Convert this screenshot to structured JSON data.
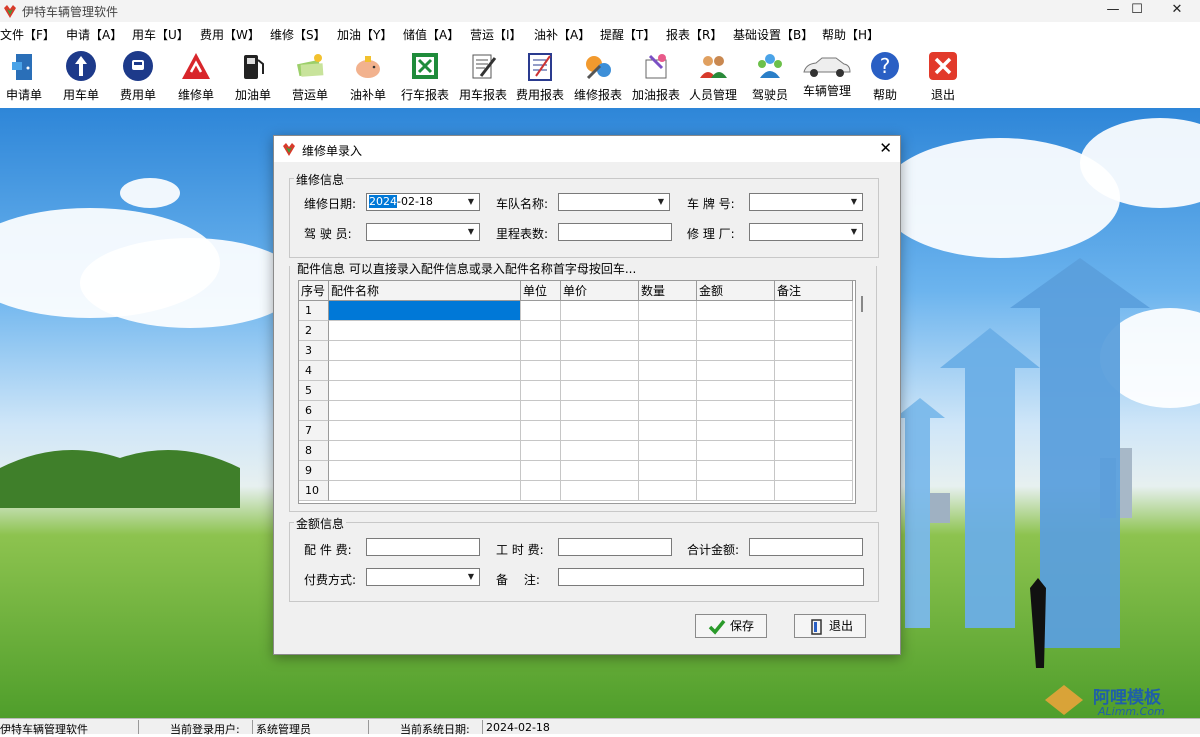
{
  "window": {
    "title": "伊特车辆管理软件",
    "controls": {
      "minimize": "—",
      "maximize": "☐",
      "close": "✕"
    }
  },
  "menu": [
    "文件【F】",
    "申请【A】",
    "用车【U】",
    "费用【W】",
    "维修【S】",
    "加油【Y】",
    "储值【A】",
    "营运【I】",
    "油补【A】",
    "提醒【T】",
    "报表【R】",
    "基础设置【B】",
    "帮助【H】"
  ],
  "toolbar": [
    "申请单",
    "用车单",
    "费用单",
    "维修单",
    "加油单",
    "营运单",
    "油补单",
    "行车报表",
    "用车报表",
    "费用报表",
    "维修报表",
    "加油报表",
    "人员管理",
    "驾驶员",
    "车辆管理",
    "帮助",
    "退出"
  ],
  "dialog": {
    "title": "维修单录入",
    "repair_info": {
      "legend": "维修信息",
      "date_label": "维修日期:",
      "date_selected": "2024",
      "date_rest": "-02-18",
      "team_label": "车队名称:",
      "plate_label": "车 牌 号:",
      "driver_label": "驾 驶 员:",
      "odometer_label": "里程表数:",
      "shop_label": "修 理 厂:"
    },
    "parts": {
      "legend": "配件信息 可以直接录入配件信息或录入配件名称首字母按回车...",
      "columns": [
        "序号",
        "配件名称",
        "单位",
        "单价",
        "数量",
        "金额",
        "备注"
      ],
      "rows": [
        "1",
        "2",
        "3",
        "4",
        "5",
        "6",
        "7",
        "8",
        "9",
        "10"
      ]
    },
    "amount": {
      "legend": "金额信息",
      "parts_fee_label": "配 件 费:",
      "labor_fee_label": "工 时 费:",
      "total_label": "合计金额:",
      "payment_label": "付费方式:",
      "remark_label": "备　 注:"
    },
    "buttons": {
      "save": "保存",
      "exit": "退出"
    }
  },
  "statusbar": {
    "app": "伊特车辆管理软件",
    "user_label": "当前登录用户:",
    "user": "系统管理员",
    "date_label": "当前系统日期:",
    "date": "2024-02-18"
  },
  "watermark": {
    "brand": "阿哩模板",
    "site": "ALimm.Com"
  }
}
